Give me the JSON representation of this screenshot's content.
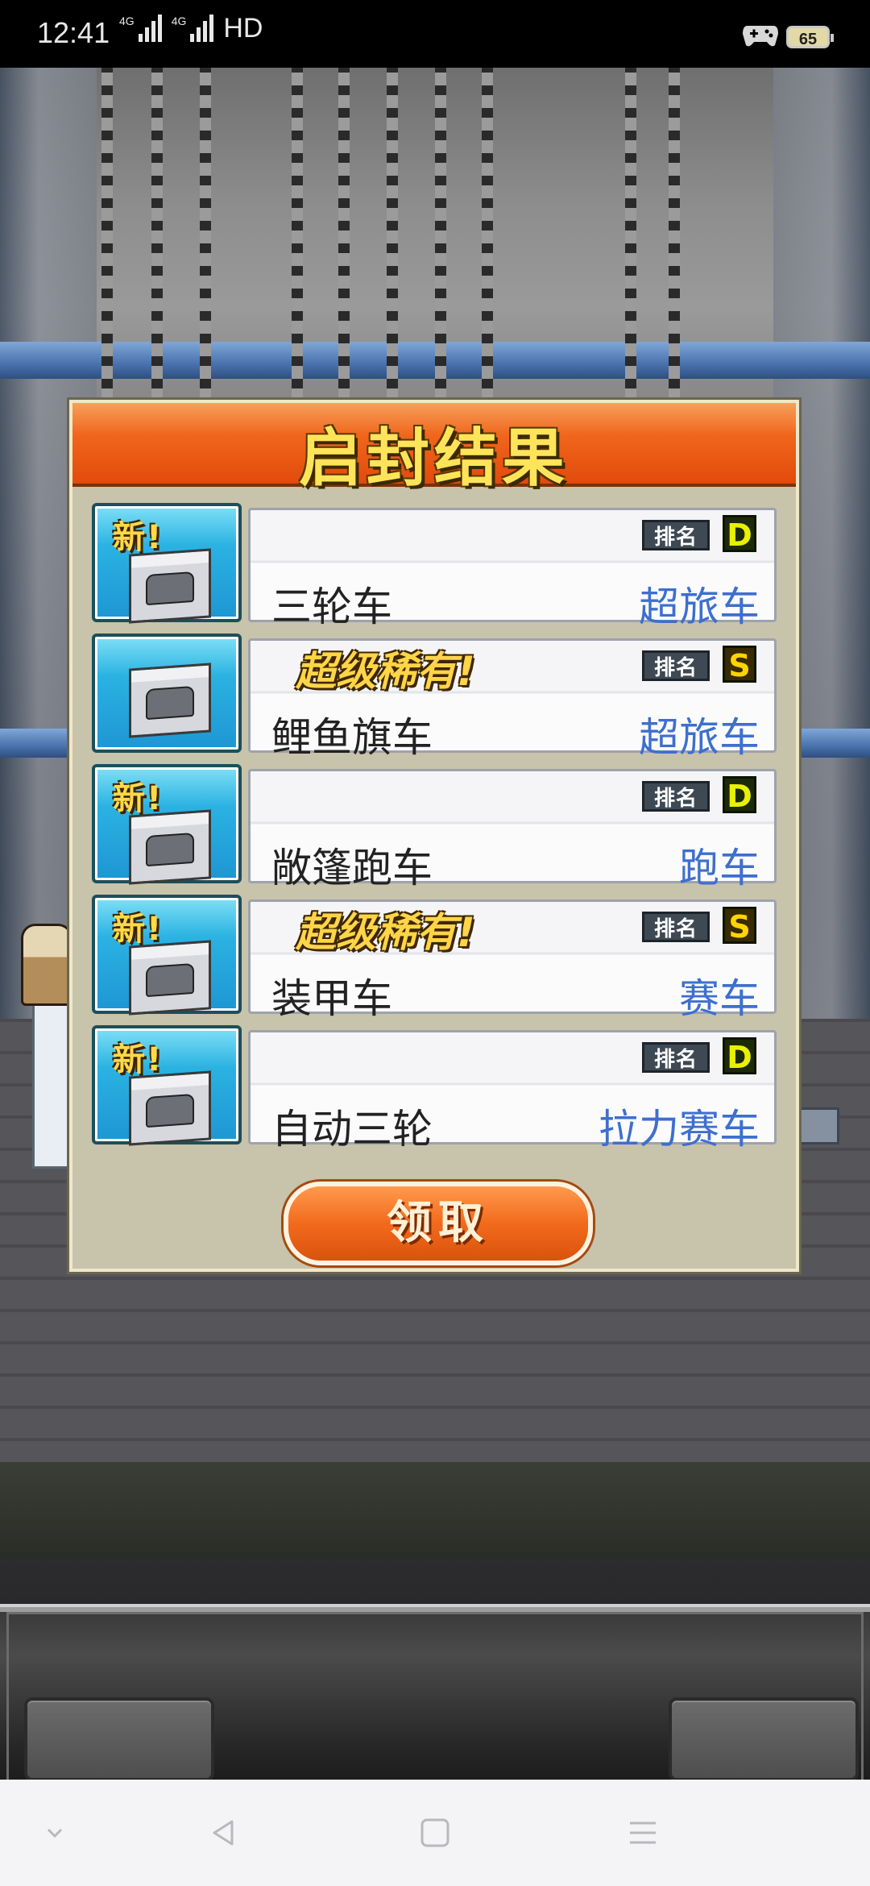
{
  "status_bar": {
    "time": "12:41",
    "network1": "4G",
    "network2": "4G",
    "hd": "HD",
    "battery": "65"
  },
  "dialog": {
    "title": "启封结果",
    "items": [
      {
        "badge": "新!",
        "super_label": "",
        "rank_label": "排名",
        "rank": "D",
        "name": "三轮车",
        "type": "超旅车"
      },
      {
        "badge": "",
        "super_label": "超级稀有!",
        "rank_label": "排名",
        "rank": "S",
        "name": "鲤鱼旗车",
        "type": "超旅车"
      },
      {
        "badge": "新!",
        "super_label": "",
        "rank_label": "排名",
        "rank": "D",
        "name": "敞篷跑车",
        "type": "跑车"
      },
      {
        "badge": "新!",
        "super_label": "超级稀有!",
        "rank_label": "排名",
        "rank": "S",
        "name": "装甲车",
        "type": "赛车"
      },
      {
        "badge": "新!",
        "super_label": "",
        "rank_label": "排名",
        "rank": "D",
        "name": "自动三轮",
        "type": "拉力赛车"
      }
    ],
    "claim_button": "领取"
  },
  "nav_icons": [
    "chevron-down-icon",
    "back-icon",
    "home-icon",
    "menu-icon"
  ]
}
